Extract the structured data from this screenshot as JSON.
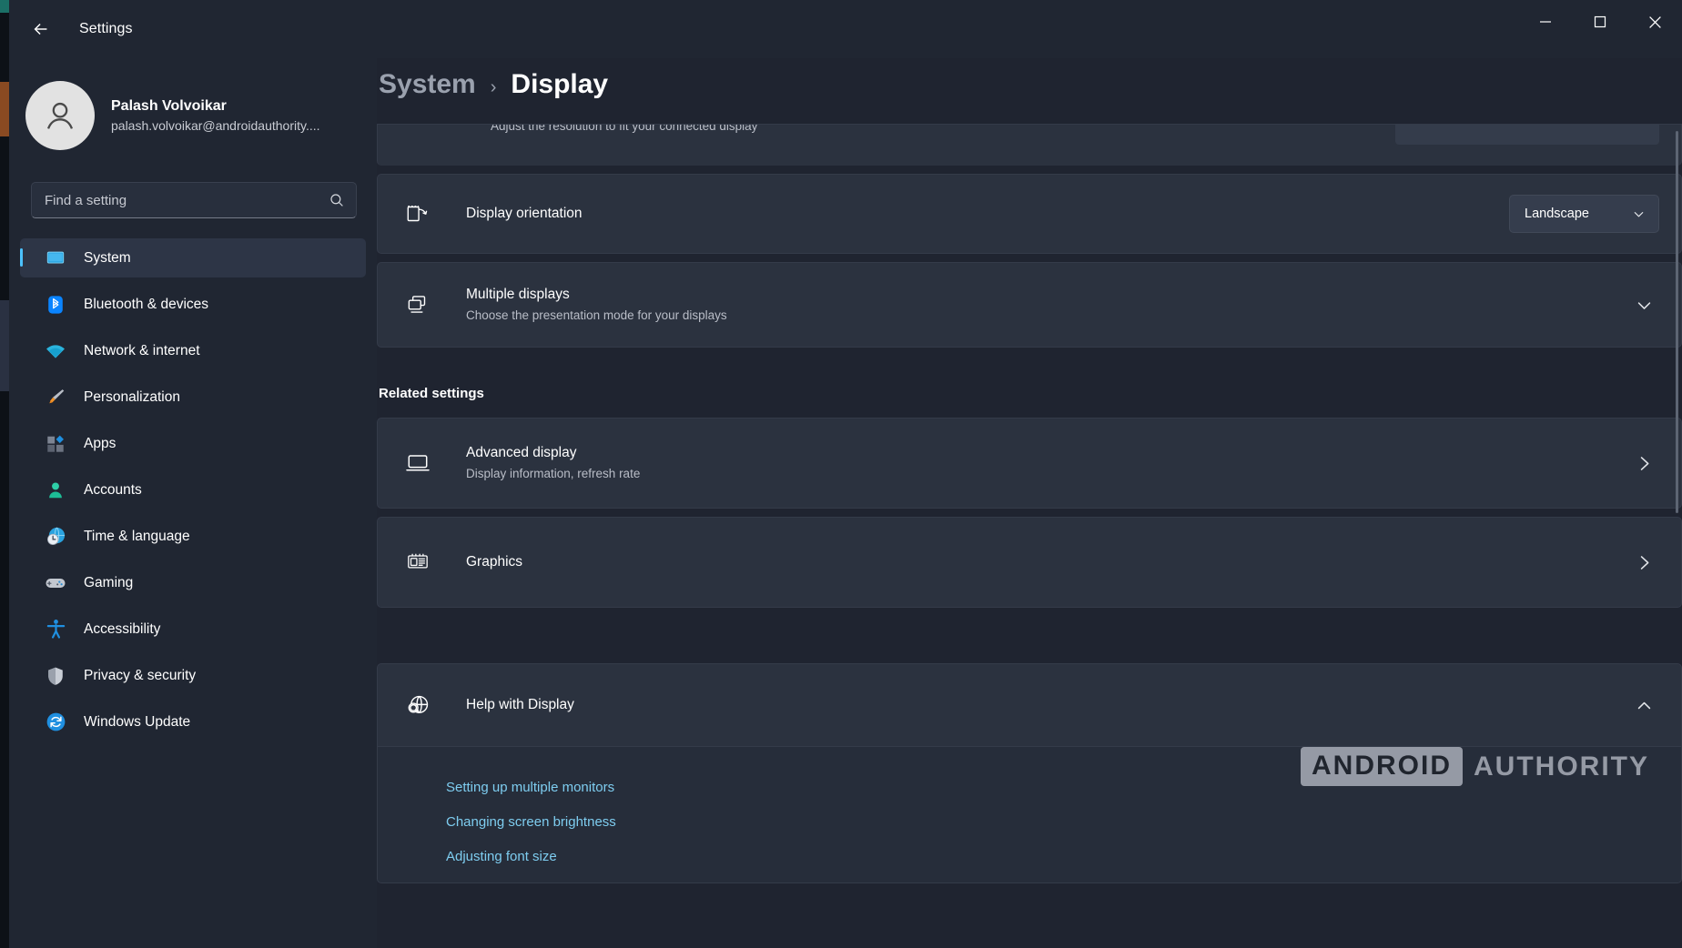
{
  "window": {
    "title": "Settings",
    "back_icon": "back-arrow-icon",
    "minimize_label": "Minimize",
    "maximize_label": "Maximize",
    "close_label": "Close"
  },
  "account": {
    "name": "Palash Volvoikar",
    "email": "palash.volvoikar@androidauthority...."
  },
  "search": {
    "placeholder": "Find a setting",
    "value": "",
    "icon": "search-icon"
  },
  "sidebar": {
    "items": [
      {
        "label": "System",
        "icon": "monitor-icon",
        "active": true
      },
      {
        "label": "Bluetooth & devices",
        "icon": "bluetooth-icon",
        "active": false
      },
      {
        "label": "Network & internet",
        "icon": "wifi-icon",
        "active": false
      },
      {
        "label": "Personalization",
        "icon": "paintbrush-icon",
        "active": false
      },
      {
        "label": "Apps",
        "icon": "apps-icon",
        "active": false
      },
      {
        "label": "Accounts",
        "icon": "person-icon",
        "active": false
      },
      {
        "label": "Time & language",
        "icon": "clock-globe-icon",
        "active": false
      },
      {
        "label": "Gaming",
        "icon": "gamepad-icon",
        "active": false
      },
      {
        "label": "Accessibility",
        "icon": "accessibility-icon",
        "active": false
      },
      {
        "label": "Privacy & security",
        "icon": "shield-icon",
        "active": false
      },
      {
        "label": "Windows Update",
        "icon": "update-refresh-icon",
        "active": false
      }
    ]
  },
  "breadcrumb": {
    "parent": "System",
    "separator": "›",
    "current": "Display"
  },
  "main": {
    "partial_row": {
      "subtitle": "Adjust the resolution to fit your connected display"
    },
    "rows": [
      {
        "title": "Display orientation",
        "subtitle": "",
        "icon": "display-orientation-icon",
        "control": "dropdown",
        "value": "Landscape"
      },
      {
        "title": "Multiple displays",
        "subtitle": "Choose the presentation mode for your displays",
        "icon": "multiple-displays-icon",
        "control": "expander",
        "value": ""
      }
    ],
    "related_settings": {
      "heading": "Related settings",
      "items": [
        {
          "title": "Advanced display",
          "subtitle": "Display information, refresh rate",
          "icon": "advanced-display-icon",
          "chevron": "chevron-right-icon"
        },
        {
          "title": "Graphics",
          "subtitle": "",
          "icon": "graphics-card-icon",
          "chevron": "chevron-right-icon"
        }
      ]
    },
    "help": {
      "title": "Help with Display",
      "icon": "help-globe-icon",
      "expander": "chevron-up-icon",
      "links": [
        "Setting up multiple monitors",
        "Changing screen brightness",
        "Adjusting font size"
      ]
    }
  },
  "watermark": {
    "brand_box": "ANDROID",
    "brand_text": "AUTHORITY"
  },
  "colors": {
    "accent": "#4cc2ff",
    "link": "#7ecdf0",
    "window_bg": "#1f2430",
    "card_bg": "#2b323f",
    "sidebar_bg": "#202632"
  }
}
